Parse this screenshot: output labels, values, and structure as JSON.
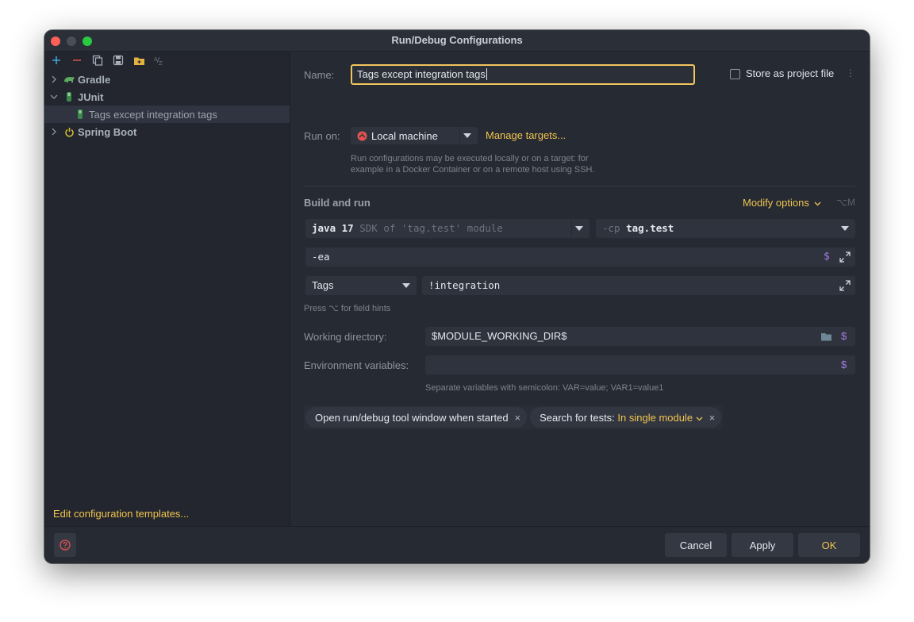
{
  "window": {
    "title": "Run/Debug Configurations"
  },
  "sidebar": {
    "tree": [
      {
        "label": "Gradle",
        "icon": "gradle-elephant-icon"
      },
      {
        "label": "JUnit",
        "icon": "junit-test-icon"
      },
      {
        "label": "Tags except integration tags",
        "icon": "junit-config-icon"
      },
      {
        "label": "Spring Boot",
        "icon": "spring-power-icon"
      }
    ],
    "edit_templates": "Edit configuration templates..."
  },
  "form": {
    "name_label": "Name:",
    "name_value": "Tags except integration tags",
    "store_label": "Store as project file",
    "run_on_label": "Run on:",
    "run_on_value": "Local machine",
    "manage_targets": "Manage targets...",
    "run_on_hint_1": "Run configurations may be executed locally or on a target: for",
    "run_on_hint_2": "example in a Docker Container or on a remote host using SSH.",
    "build_and_run": "Build and run",
    "modify_options": "Modify options",
    "modify_shortcut": "⌥M",
    "jdk_strong": "java 17",
    "jdk_dim": "SDK of 'tag.test' module",
    "cp_dim": "-cp",
    "cp_value": "tag.test",
    "vm_options": "-ea",
    "test_kind": "Tags",
    "tags_value": "!integration",
    "field_hint": "Press ⌥ for field hints",
    "workdir_label": "Working directory:",
    "workdir_value": "$MODULE_WORKING_DIR$",
    "env_label": "Environment variables:",
    "env_value": "",
    "env_hint": "Separate variables with semicolon: VAR=value; VAR1=value1",
    "chip_open_tool": "Open run/debug tool window when started",
    "chip_search_prefix": "Search for tests:",
    "chip_search_value": "In single module"
  },
  "footer": {
    "cancel": "Cancel",
    "apply": "Apply",
    "ok": "OK"
  },
  "colors": {
    "accent": "#f0c44f",
    "background": "#262a33",
    "sidebar": "#23262e",
    "field": "#2f333d",
    "dollar": "#a27de3"
  }
}
